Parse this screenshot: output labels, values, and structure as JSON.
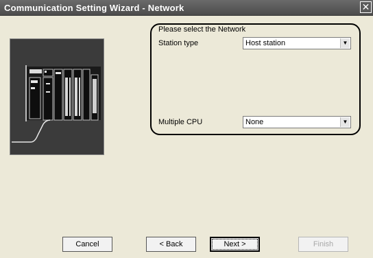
{
  "window": {
    "title": "Communication Setting Wizard - Network",
    "close_symbol": "✕"
  },
  "group": {
    "label": "Please select the Network",
    "station_type": {
      "label": "Station type",
      "value": "Host station"
    },
    "multiple_cpu": {
      "label": "Multiple CPU",
      "value": "None"
    }
  },
  "buttons": {
    "cancel": "Cancel",
    "back": "< Back",
    "next": "Next >",
    "finish": "Finish"
  },
  "icons": {
    "dropdown": "▼"
  }
}
